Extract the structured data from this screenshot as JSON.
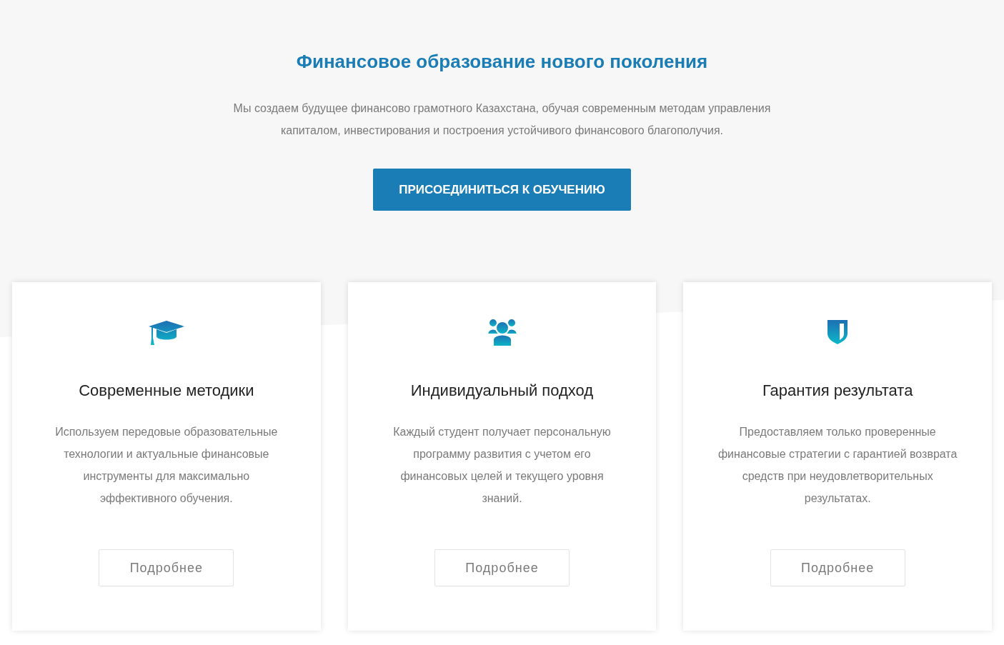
{
  "hero": {
    "title": "Финансовое образование нового поколения",
    "text": "Мы создаем будущее финансово грамотного Казахстана, обучая современным методам управления капиталом, инвестирования и построения устойчивого финансового благополучия.",
    "button": "ПРИСОЕДИНИТЬСЯ К ОБУЧЕНИЮ"
  },
  "features": [
    {
      "title": "Современные методики",
      "text": "Используем передовые образовательные технологии и актуальные финансовые инструменты для максимально эффективного обучения.",
      "button": "Подробнее"
    },
    {
      "title": "Индивидуальный подход",
      "text": "Каждый студент получает персональную программу развития с учетом его финансовых целей и текущего уровня знаний.",
      "button": "Подробнее"
    },
    {
      "title": "Гарантия результата",
      "text": "Предоставляем только проверенные финансовые стратегии с гарантией возврата средств при неудовлетворительных результатах.",
      "button": "Подробнее"
    }
  ]
}
